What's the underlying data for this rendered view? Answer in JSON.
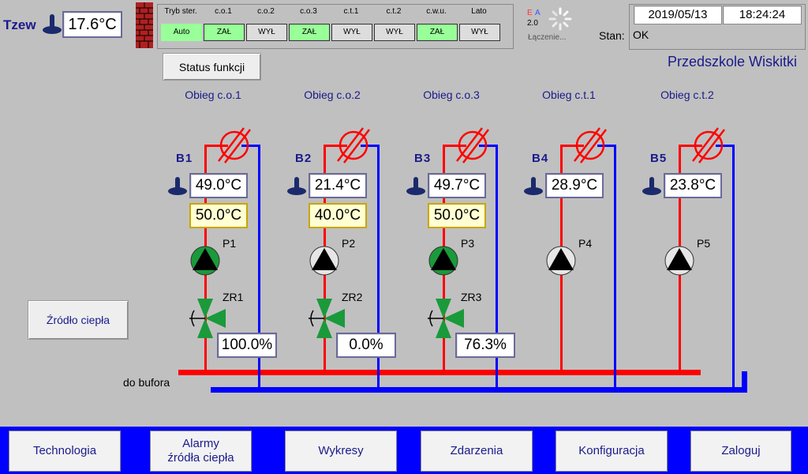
{
  "header": {
    "tzew_label": "Tzew",
    "tzew_value": "17.6°C",
    "date": "2019/05/13",
    "time": "18:24:24",
    "stan_label": "Stan:",
    "stan_value": "OK",
    "ea_e": "E",
    "ea_a": "A",
    "ea_version": "2.0",
    "connecting": "Łączenie...",
    "site_name": "Przedszkole Wiskitki"
  },
  "status_panel": {
    "headers": [
      "Tryb ster.",
      "c.o.1",
      "c.o.2",
      "c.o.3",
      "c.t.1",
      "c.t.2",
      "c.w.u.",
      "Lato"
    ],
    "values": [
      "Auto",
      "ZAŁ",
      "WYŁ",
      "ZAŁ",
      "WYŁ",
      "WYŁ",
      "ZAŁ",
      "WYŁ"
    ],
    "colors": [
      "#99ff99",
      "#99ff99",
      "#dddddd",
      "#99ff99",
      "#dddddd",
      "#dddddd",
      "#99ff99",
      "#dddddd"
    ]
  },
  "status_funkcji_label": "Status funkcji",
  "zrodlo_label": "Źródło ciepła",
  "do_bufora_label": "do bufora",
  "circuits": [
    {
      "title": "Obieg c.o.1",
      "b": "B1",
      "temp": "49.0°C",
      "setpoint": "50.0°C",
      "pump": "P1",
      "pump_on": true,
      "valve": "ZR1",
      "valve_pct": "100.0%"
    },
    {
      "title": "Obieg c.o.2",
      "b": "B2",
      "temp": "21.4°C",
      "setpoint": "40.0°C",
      "pump": "P2",
      "pump_on": false,
      "valve": "ZR2",
      "valve_pct": "0.0%"
    },
    {
      "title": "Obieg c.o.3",
      "b": "B3",
      "temp": "49.7°C",
      "setpoint": "50.0°C",
      "pump": "P3",
      "pump_on": true,
      "valve": "ZR3",
      "valve_pct": "76.3%"
    },
    {
      "title": "Obieg c.t.1",
      "b": "B4",
      "temp": "28.9°C",
      "pump": "P4",
      "pump_on": false
    },
    {
      "title": "Obieg c.t.2",
      "b": "B5",
      "temp": "23.8°C",
      "pump": "P5",
      "pump_on": false
    }
  ],
  "nav": [
    "Technologia",
    "Alarmy\nźródła ciepła",
    "Wykresy",
    "Zdarzenia",
    "Konfiguracja",
    "Zaloguj"
  ],
  "colors": {
    "supply": "#ff0000",
    "return": "#0000ff",
    "pump_on": "#1a9a3a",
    "valve": "#1a9a3a",
    "title": "#1a1a8c",
    "nav_bar": "#0000ff"
  }
}
